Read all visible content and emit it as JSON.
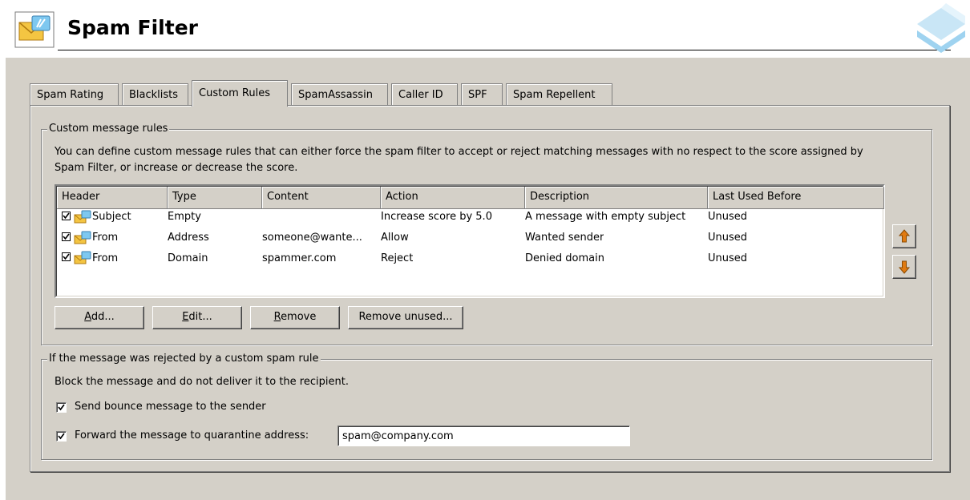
{
  "header": {
    "title": "Spam Filter",
    "app_icon": "mail-filter-icon",
    "logo": "brand-logo-icon"
  },
  "tabs": [
    {
      "label": "Spam Rating",
      "active": false
    },
    {
      "label": "Blacklists",
      "active": false
    },
    {
      "label": "Custom Rules",
      "active": true
    },
    {
      "label": "SpamAssassin",
      "active": false
    },
    {
      "label": "Caller ID",
      "active": false
    },
    {
      "label": "SPF",
      "active": false
    },
    {
      "label": "Spam Repellent",
      "active": false
    }
  ],
  "rules_group": {
    "title": "Custom message rules",
    "description_line1": "You can define custom message rules that can either force the spam filter to accept or reject matching messages with no respect to the score assigned by",
    "description_line2": "Spam Filter, or increase or decrease the score.",
    "columns": [
      "Header",
      "Type",
      "Content",
      "Action",
      "Description",
      "Last Used Before"
    ],
    "rows": [
      {
        "checked": true,
        "header": "Subject",
        "type": "Empty",
        "content": "",
        "action": "Increase score by 5.0",
        "description": "A message with empty subject",
        "last_used": "Unused"
      },
      {
        "checked": true,
        "header": "From",
        "type": "Address",
        "content": "someone@wante...",
        "action": "Allow",
        "description": "Wanted sender",
        "last_used": "Unused"
      },
      {
        "checked": true,
        "header": "From",
        "type": "Domain",
        "content": "spammer.com",
        "action": "Reject",
        "description": "Denied domain",
        "last_used": "Unused"
      }
    ],
    "buttons": {
      "add": {
        "mnemonic": "A",
        "rest": "dd..."
      },
      "edit": {
        "mnemonic": "E",
        "rest": "dit..."
      },
      "remove": {
        "mnemonic": "R",
        "rest": "emove"
      },
      "remove_unused": "Remove unused..."
    },
    "move_up_icon": "arrow-up-icon",
    "move_down_icon": "arrow-down-icon"
  },
  "rejected_group": {
    "title": "If the message was rejected by a custom spam rule",
    "info": "Block the message and do not deliver it to the recipient.",
    "send_bounce": {
      "label": "Send bounce message to the sender",
      "checked": true
    },
    "forward": {
      "label": "Forward the message to quarantine address:",
      "checked": true,
      "value": "spam@company.com"
    }
  },
  "colors": {
    "dialog_bg": "#d4d0c8",
    "arrow_orange": "#e07a10"
  }
}
